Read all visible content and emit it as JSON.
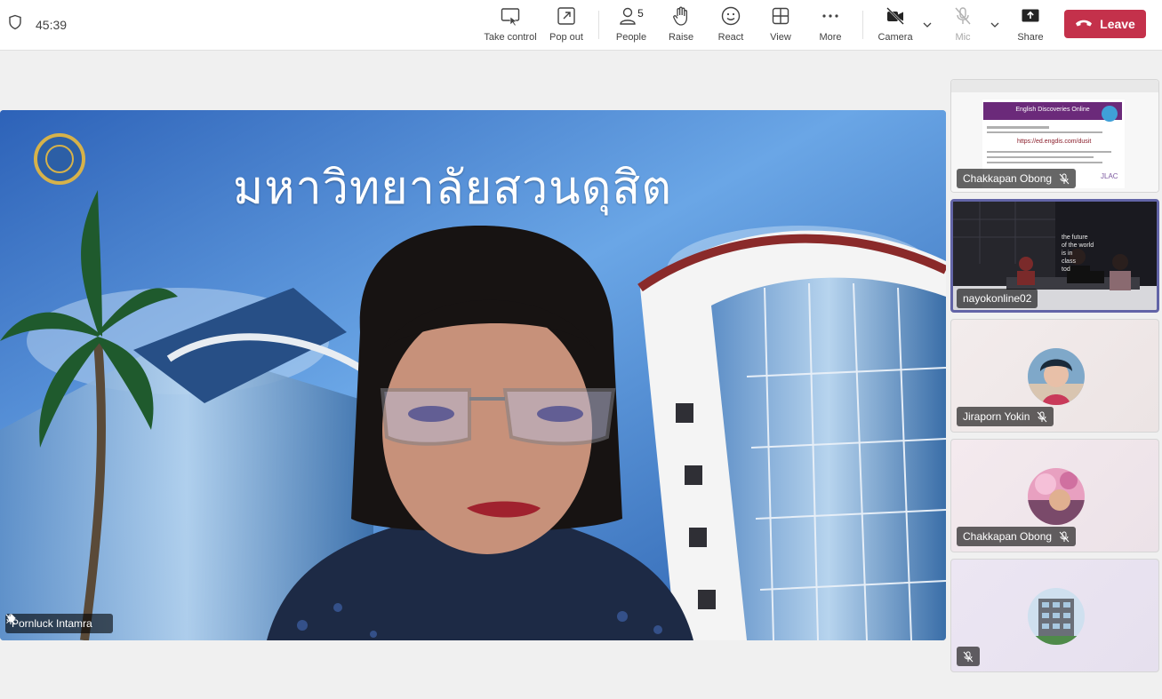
{
  "toolbar": {
    "timer": "45:39",
    "take_control": "Take control",
    "pop_out": "Pop out",
    "people": "People",
    "people_count": "5",
    "raise": "Raise",
    "react": "React",
    "view": "View",
    "more": "More",
    "camera": "Camera",
    "mic": "Mic",
    "share": "Share",
    "leave": "Leave",
    "leave_color": "#c4314b"
  },
  "stage": {
    "background_title": "มหาวิทยาลัยสวนดุสิต",
    "speaker_name": "Pornluck Intamra"
  },
  "participants": [
    {
      "name": "Chakkapan Obong",
      "content": "screen-share"
    },
    {
      "name": "nayokonline02",
      "content": "video",
      "active": true
    },
    {
      "name": "Jiraporn Yokin",
      "content": "avatar"
    },
    {
      "name": "Chakkapan Obong",
      "content": "avatar"
    },
    {
      "name": "",
      "content": "avatar"
    }
  ],
  "screen_share_text": {
    "heading": "English Discoveries Online",
    "url": "https://ed.engdis.com/dusit",
    "logo": "JLAC"
  },
  "room_video_text": [
    "the future",
    "of the world",
    "is in",
    "class",
    "tod"
  ]
}
